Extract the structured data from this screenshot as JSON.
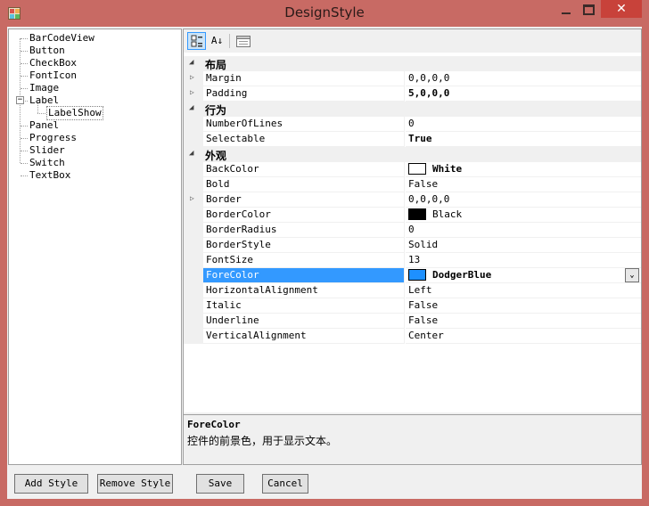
{
  "window": {
    "title": "DesignStyle",
    "close_glyph": "✕",
    "colors": {
      "frame": "#c86a64",
      "close": "#c8423a",
      "accent": "#3399ff"
    }
  },
  "tree": {
    "items": [
      {
        "label": "BarCodeView",
        "level": 0
      },
      {
        "label": "Button",
        "level": 0
      },
      {
        "label": "CheckBox",
        "level": 0
      },
      {
        "label": "FontIcon",
        "level": 0
      },
      {
        "label": "Image",
        "level": 0
      },
      {
        "label": "Label",
        "level": 0,
        "expanded": true
      },
      {
        "label": "LabelShow",
        "level": 1,
        "selected": true
      },
      {
        "label": "Panel",
        "level": 0
      },
      {
        "label": "Progress",
        "level": 0
      },
      {
        "label": "Slider",
        "level": 0
      },
      {
        "label": "Switch",
        "level": 0
      },
      {
        "label": "TextBox",
        "level": 0
      }
    ],
    "collapse_glyph": "−"
  },
  "toolbar": {
    "categorized_icon": "categorized-icon",
    "alphabetical_icon": "sort-az-icon",
    "alphabetical_glyph": "A↓",
    "property_pages_icon": "property-pages-icon"
  },
  "grid": {
    "categories": [
      {
        "label": "布局",
        "props": [
          {
            "name": "Margin",
            "value": "0,0,0,0",
            "expandable": true
          },
          {
            "name": "Padding",
            "value": "5,0,0,0",
            "expandable": true,
            "bold": true
          }
        ]
      },
      {
        "label": "行为",
        "props": [
          {
            "name": "NumberOfLines",
            "value": "0"
          },
          {
            "name": "Selectable",
            "value": "True",
            "bold": true
          }
        ]
      },
      {
        "label": "外观",
        "props": [
          {
            "name": "BackColor",
            "value": "White",
            "bold": true,
            "swatch": "#ffffff"
          },
          {
            "name": "Bold",
            "value": "False"
          },
          {
            "name": "Border",
            "value": "0,0,0,0",
            "expandable": true
          },
          {
            "name": "BorderColor",
            "value": "Black",
            "swatch": "#000000"
          },
          {
            "name": "BorderRadius",
            "value": "0"
          },
          {
            "name": "BorderStyle",
            "value": "Solid"
          },
          {
            "name": "FontSize",
            "value": "13"
          },
          {
            "name": "ForeColor",
            "value": "DodgerBlue",
            "bold": true,
            "swatch": "#1e90ff",
            "selected": true
          },
          {
            "name": "HorizontalAlignment",
            "value": "Left"
          },
          {
            "name": "Italic",
            "value": "False"
          },
          {
            "name": "Underline",
            "value": "False"
          },
          {
            "name": "VerticalAlignment",
            "value": "Center"
          }
        ]
      }
    ],
    "expander_glyph": "▷",
    "category_glyph": "◢",
    "dropdown_glyph": "⌄"
  },
  "help": {
    "title": "ForeColor",
    "description": "控件的前景色，用于显示文本。"
  },
  "buttons": {
    "add_style": "Add Style",
    "remove_style": "Remove Style",
    "save": "Save",
    "cancel": "Cancel"
  }
}
